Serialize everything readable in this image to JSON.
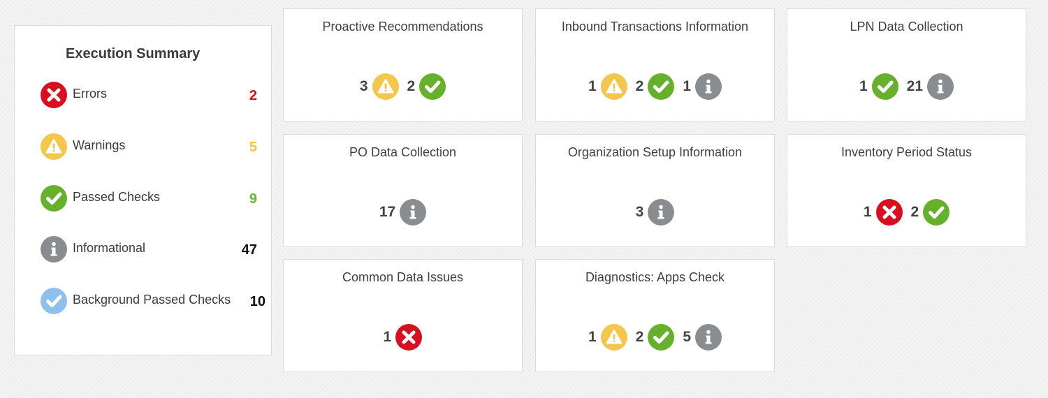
{
  "summary": {
    "title": "Execution Summary",
    "rows": [
      {
        "label": "Errors",
        "count": "2",
        "icon": "error-icon",
        "color": "#d70f1f"
      },
      {
        "label": "Warnings",
        "count": "5",
        "icon": "warning-icon",
        "color": "#f0c443"
      },
      {
        "label": "Passed Checks",
        "count": "9",
        "icon": "check-icon",
        "color": "#6cb22c"
      },
      {
        "label": "Informational",
        "count": "47",
        "icon": "info-icon",
        "color": "#111111"
      },
      {
        "label": "Background Passed Checks",
        "count": "10",
        "icon": "background-check-icon",
        "color": "#111111"
      }
    ]
  },
  "cards": [
    {
      "title": "Proactive Recommendations",
      "stats": [
        {
          "value": "3",
          "type": "warning"
        },
        {
          "value": "2",
          "type": "pass"
        }
      ]
    },
    {
      "title": "Inbound Transactions Information",
      "stats": [
        {
          "value": "1",
          "type": "warning"
        },
        {
          "value": "2",
          "type": "pass"
        },
        {
          "value": "1",
          "type": "info"
        }
      ]
    },
    {
      "title": "LPN Data Collection",
      "stats": [
        {
          "value": "1",
          "type": "pass"
        },
        {
          "value": "21",
          "type": "info"
        }
      ]
    },
    {
      "title": "PO Data Collection",
      "stats": [
        {
          "value": "17",
          "type": "info"
        }
      ]
    },
    {
      "title": "Organization Setup Information",
      "stats": [
        {
          "value": "3",
          "type": "info"
        }
      ]
    },
    {
      "title": "Inventory Period Status",
      "stats": [
        {
          "value": "1",
          "type": "error"
        },
        {
          "value": "2",
          "type": "pass"
        }
      ]
    },
    {
      "title": "Common Data Issues",
      "stats": [
        {
          "value": "1",
          "type": "error"
        }
      ]
    },
    {
      "title": "Diagnostics: Apps Check",
      "stats": [
        {
          "value": "1",
          "type": "warning"
        },
        {
          "value": "2",
          "type": "pass"
        },
        {
          "value": "5",
          "type": "info"
        }
      ]
    }
  ],
  "colors": {
    "error": "#d70f1f",
    "warning": "#f3c64d",
    "pass": "#66b12b",
    "info": "#8a8d90",
    "background_pass": "#8ec0ee"
  }
}
